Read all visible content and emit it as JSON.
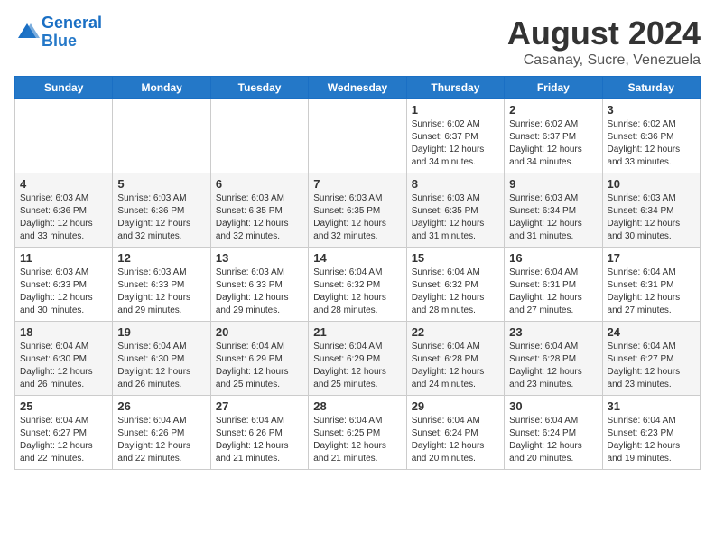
{
  "header": {
    "logo_line1": "General",
    "logo_line2": "Blue",
    "month": "August 2024",
    "location": "Casanay, Sucre, Venezuela"
  },
  "days_of_week": [
    "Sunday",
    "Monday",
    "Tuesday",
    "Wednesday",
    "Thursday",
    "Friday",
    "Saturday"
  ],
  "weeks": [
    [
      {
        "day": "",
        "info": ""
      },
      {
        "day": "",
        "info": ""
      },
      {
        "day": "",
        "info": ""
      },
      {
        "day": "",
        "info": ""
      },
      {
        "day": "1",
        "info": "Sunrise: 6:02 AM\nSunset: 6:37 PM\nDaylight: 12 hours\nand 34 minutes."
      },
      {
        "day": "2",
        "info": "Sunrise: 6:02 AM\nSunset: 6:37 PM\nDaylight: 12 hours\nand 34 minutes."
      },
      {
        "day": "3",
        "info": "Sunrise: 6:02 AM\nSunset: 6:36 PM\nDaylight: 12 hours\nand 33 minutes."
      }
    ],
    [
      {
        "day": "4",
        "info": "Sunrise: 6:03 AM\nSunset: 6:36 PM\nDaylight: 12 hours\nand 33 minutes."
      },
      {
        "day": "5",
        "info": "Sunrise: 6:03 AM\nSunset: 6:36 PM\nDaylight: 12 hours\nand 32 minutes."
      },
      {
        "day": "6",
        "info": "Sunrise: 6:03 AM\nSunset: 6:35 PM\nDaylight: 12 hours\nand 32 minutes."
      },
      {
        "day": "7",
        "info": "Sunrise: 6:03 AM\nSunset: 6:35 PM\nDaylight: 12 hours\nand 32 minutes."
      },
      {
        "day": "8",
        "info": "Sunrise: 6:03 AM\nSunset: 6:35 PM\nDaylight: 12 hours\nand 31 minutes."
      },
      {
        "day": "9",
        "info": "Sunrise: 6:03 AM\nSunset: 6:34 PM\nDaylight: 12 hours\nand 31 minutes."
      },
      {
        "day": "10",
        "info": "Sunrise: 6:03 AM\nSunset: 6:34 PM\nDaylight: 12 hours\nand 30 minutes."
      }
    ],
    [
      {
        "day": "11",
        "info": "Sunrise: 6:03 AM\nSunset: 6:33 PM\nDaylight: 12 hours\nand 30 minutes."
      },
      {
        "day": "12",
        "info": "Sunrise: 6:03 AM\nSunset: 6:33 PM\nDaylight: 12 hours\nand 29 minutes."
      },
      {
        "day": "13",
        "info": "Sunrise: 6:03 AM\nSunset: 6:33 PM\nDaylight: 12 hours\nand 29 minutes."
      },
      {
        "day": "14",
        "info": "Sunrise: 6:04 AM\nSunset: 6:32 PM\nDaylight: 12 hours\nand 28 minutes."
      },
      {
        "day": "15",
        "info": "Sunrise: 6:04 AM\nSunset: 6:32 PM\nDaylight: 12 hours\nand 28 minutes."
      },
      {
        "day": "16",
        "info": "Sunrise: 6:04 AM\nSunset: 6:31 PM\nDaylight: 12 hours\nand 27 minutes."
      },
      {
        "day": "17",
        "info": "Sunrise: 6:04 AM\nSunset: 6:31 PM\nDaylight: 12 hours\nand 27 minutes."
      }
    ],
    [
      {
        "day": "18",
        "info": "Sunrise: 6:04 AM\nSunset: 6:30 PM\nDaylight: 12 hours\nand 26 minutes."
      },
      {
        "day": "19",
        "info": "Sunrise: 6:04 AM\nSunset: 6:30 PM\nDaylight: 12 hours\nand 26 minutes."
      },
      {
        "day": "20",
        "info": "Sunrise: 6:04 AM\nSunset: 6:29 PM\nDaylight: 12 hours\nand 25 minutes."
      },
      {
        "day": "21",
        "info": "Sunrise: 6:04 AM\nSunset: 6:29 PM\nDaylight: 12 hours\nand 25 minutes."
      },
      {
        "day": "22",
        "info": "Sunrise: 6:04 AM\nSunset: 6:28 PM\nDaylight: 12 hours\nand 24 minutes."
      },
      {
        "day": "23",
        "info": "Sunrise: 6:04 AM\nSunset: 6:28 PM\nDaylight: 12 hours\nand 23 minutes."
      },
      {
        "day": "24",
        "info": "Sunrise: 6:04 AM\nSunset: 6:27 PM\nDaylight: 12 hours\nand 23 minutes."
      }
    ],
    [
      {
        "day": "25",
        "info": "Sunrise: 6:04 AM\nSunset: 6:27 PM\nDaylight: 12 hours\nand 22 minutes."
      },
      {
        "day": "26",
        "info": "Sunrise: 6:04 AM\nSunset: 6:26 PM\nDaylight: 12 hours\nand 22 minutes."
      },
      {
        "day": "27",
        "info": "Sunrise: 6:04 AM\nSunset: 6:26 PM\nDaylight: 12 hours\nand 21 minutes."
      },
      {
        "day": "28",
        "info": "Sunrise: 6:04 AM\nSunset: 6:25 PM\nDaylight: 12 hours\nand 21 minutes."
      },
      {
        "day": "29",
        "info": "Sunrise: 6:04 AM\nSunset: 6:24 PM\nDaylight: 12 hours\nand 20 minutes."
      },
      {
        "day": "30",
        "info": "Sunrise: 6:04 AM\nSunset: 6:24 PM\nDaylight: 12 hours\nand 20 minutes."
      },
      {
        "day": "31",
        "info": "Sunrise: 6:04 AM\nSunset: 6:23 PM\nDaylight: 12 hours\nand 19 minutes."
      }
    ]
  ]
}
